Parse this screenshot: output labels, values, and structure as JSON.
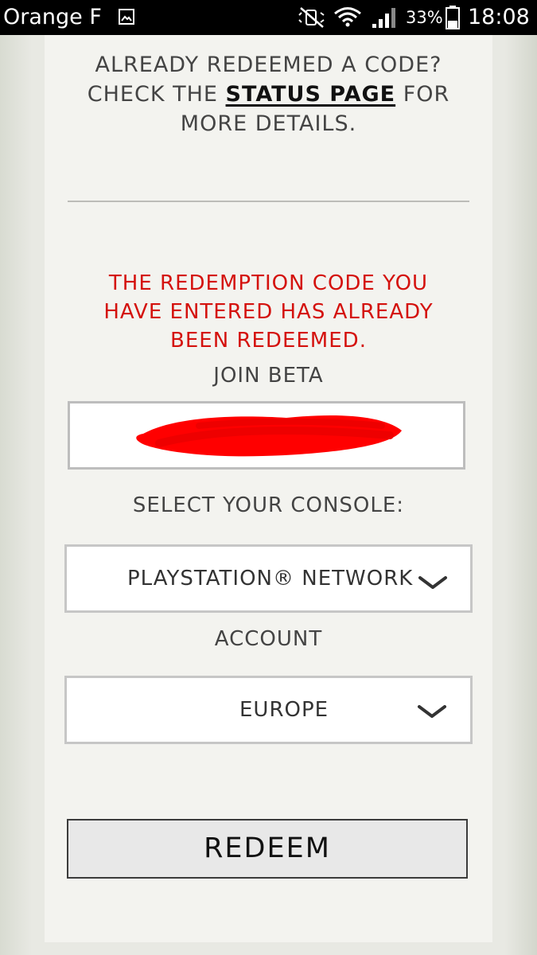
{
  "status_bar": {
    "carrier": "Orange F",
    "battery_percent": "33%",
    "time": "18:08"
  },
  "intro": {
    "line1": "ALREADY REDEEMED A CODE?",
    "line2_prefix": "CHECK THE ",
    "status_link": "STATUS PAGE",
    "line2_suffix": " FOR",
    "line3": "MORE DETAILS."
  },
  "error": {
    "line1": "THE REDEMPTION CODE YOU",
    "line2": "HAVE ENTERED HAS ALREADY",
    "line3": "BEEN REDEEMED."
  },
  "form": {
    "join_label": "JOIN BETA",
    "code_value": "",
    "console_label": "SELECT YOUR CONSOLE:",
    "console_value": "PLAYSTATION® NETWORK",
    "account_label": "ACCOUNT",
    "region_value": "EUROPE",
    "submit_label": "REDEEM"
  },
  "colors": {
    "error_text": "#d4110d",
    "redaction": "#ff0000"
  },
  "icons": [
    "picture-icon",
    "mute-icon",
    "wifi-icon",
    "signal-icon",
    "battery-icon",
    "chevron-down-icon"
  ]
}
